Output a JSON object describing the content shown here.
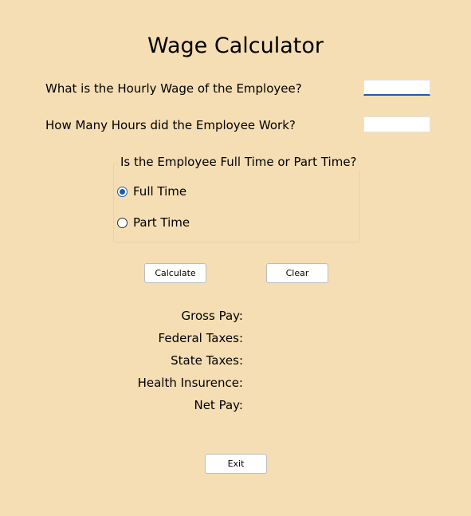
{
  "window": {
    "title": "Wage Calculator"
  },
  "inputs": {
    "hourly_wage": {
      "label": "What is the Hourly Wage of the Employee?",
      "value": ""
    },
    "hours_worked": {
      "label": "How Many Hours did the Employee Work?",
      "value": ""
    }
  },
  "employment_type": {
    "question": "Is the Employee Full Time or Part Time?",
    "options": [
      {
        "label": "Full Time",
        "selected": true
      },
      {
        "label": "Part Time",
        "selected": false
      }
    ]
  },
  "buttons": {
    "calculate": "Calculate",
    "clear": "Clear",
    "exit": "Exit"
  },
  "results": {
    "gross_pay": {
      "label": "Gross Pay:",
      "value": ""
    },
    "federal_taxes": {
      "label": "Federal Taxes:",
      "value": ""
    },
    "state_taxes": {
      "label": "State Taxes:",
      "value": ""
    },
    "health_insurance": {
      "label": "Health Insurence:",
      "value": ""
    },
    "net_pay": {
      "label": "Net Pay:",
      "value": ""
    }
  },
  "colors": {
    "background": "#F5DEB3",
    "accent": "#1E5DA8"
  }
}
